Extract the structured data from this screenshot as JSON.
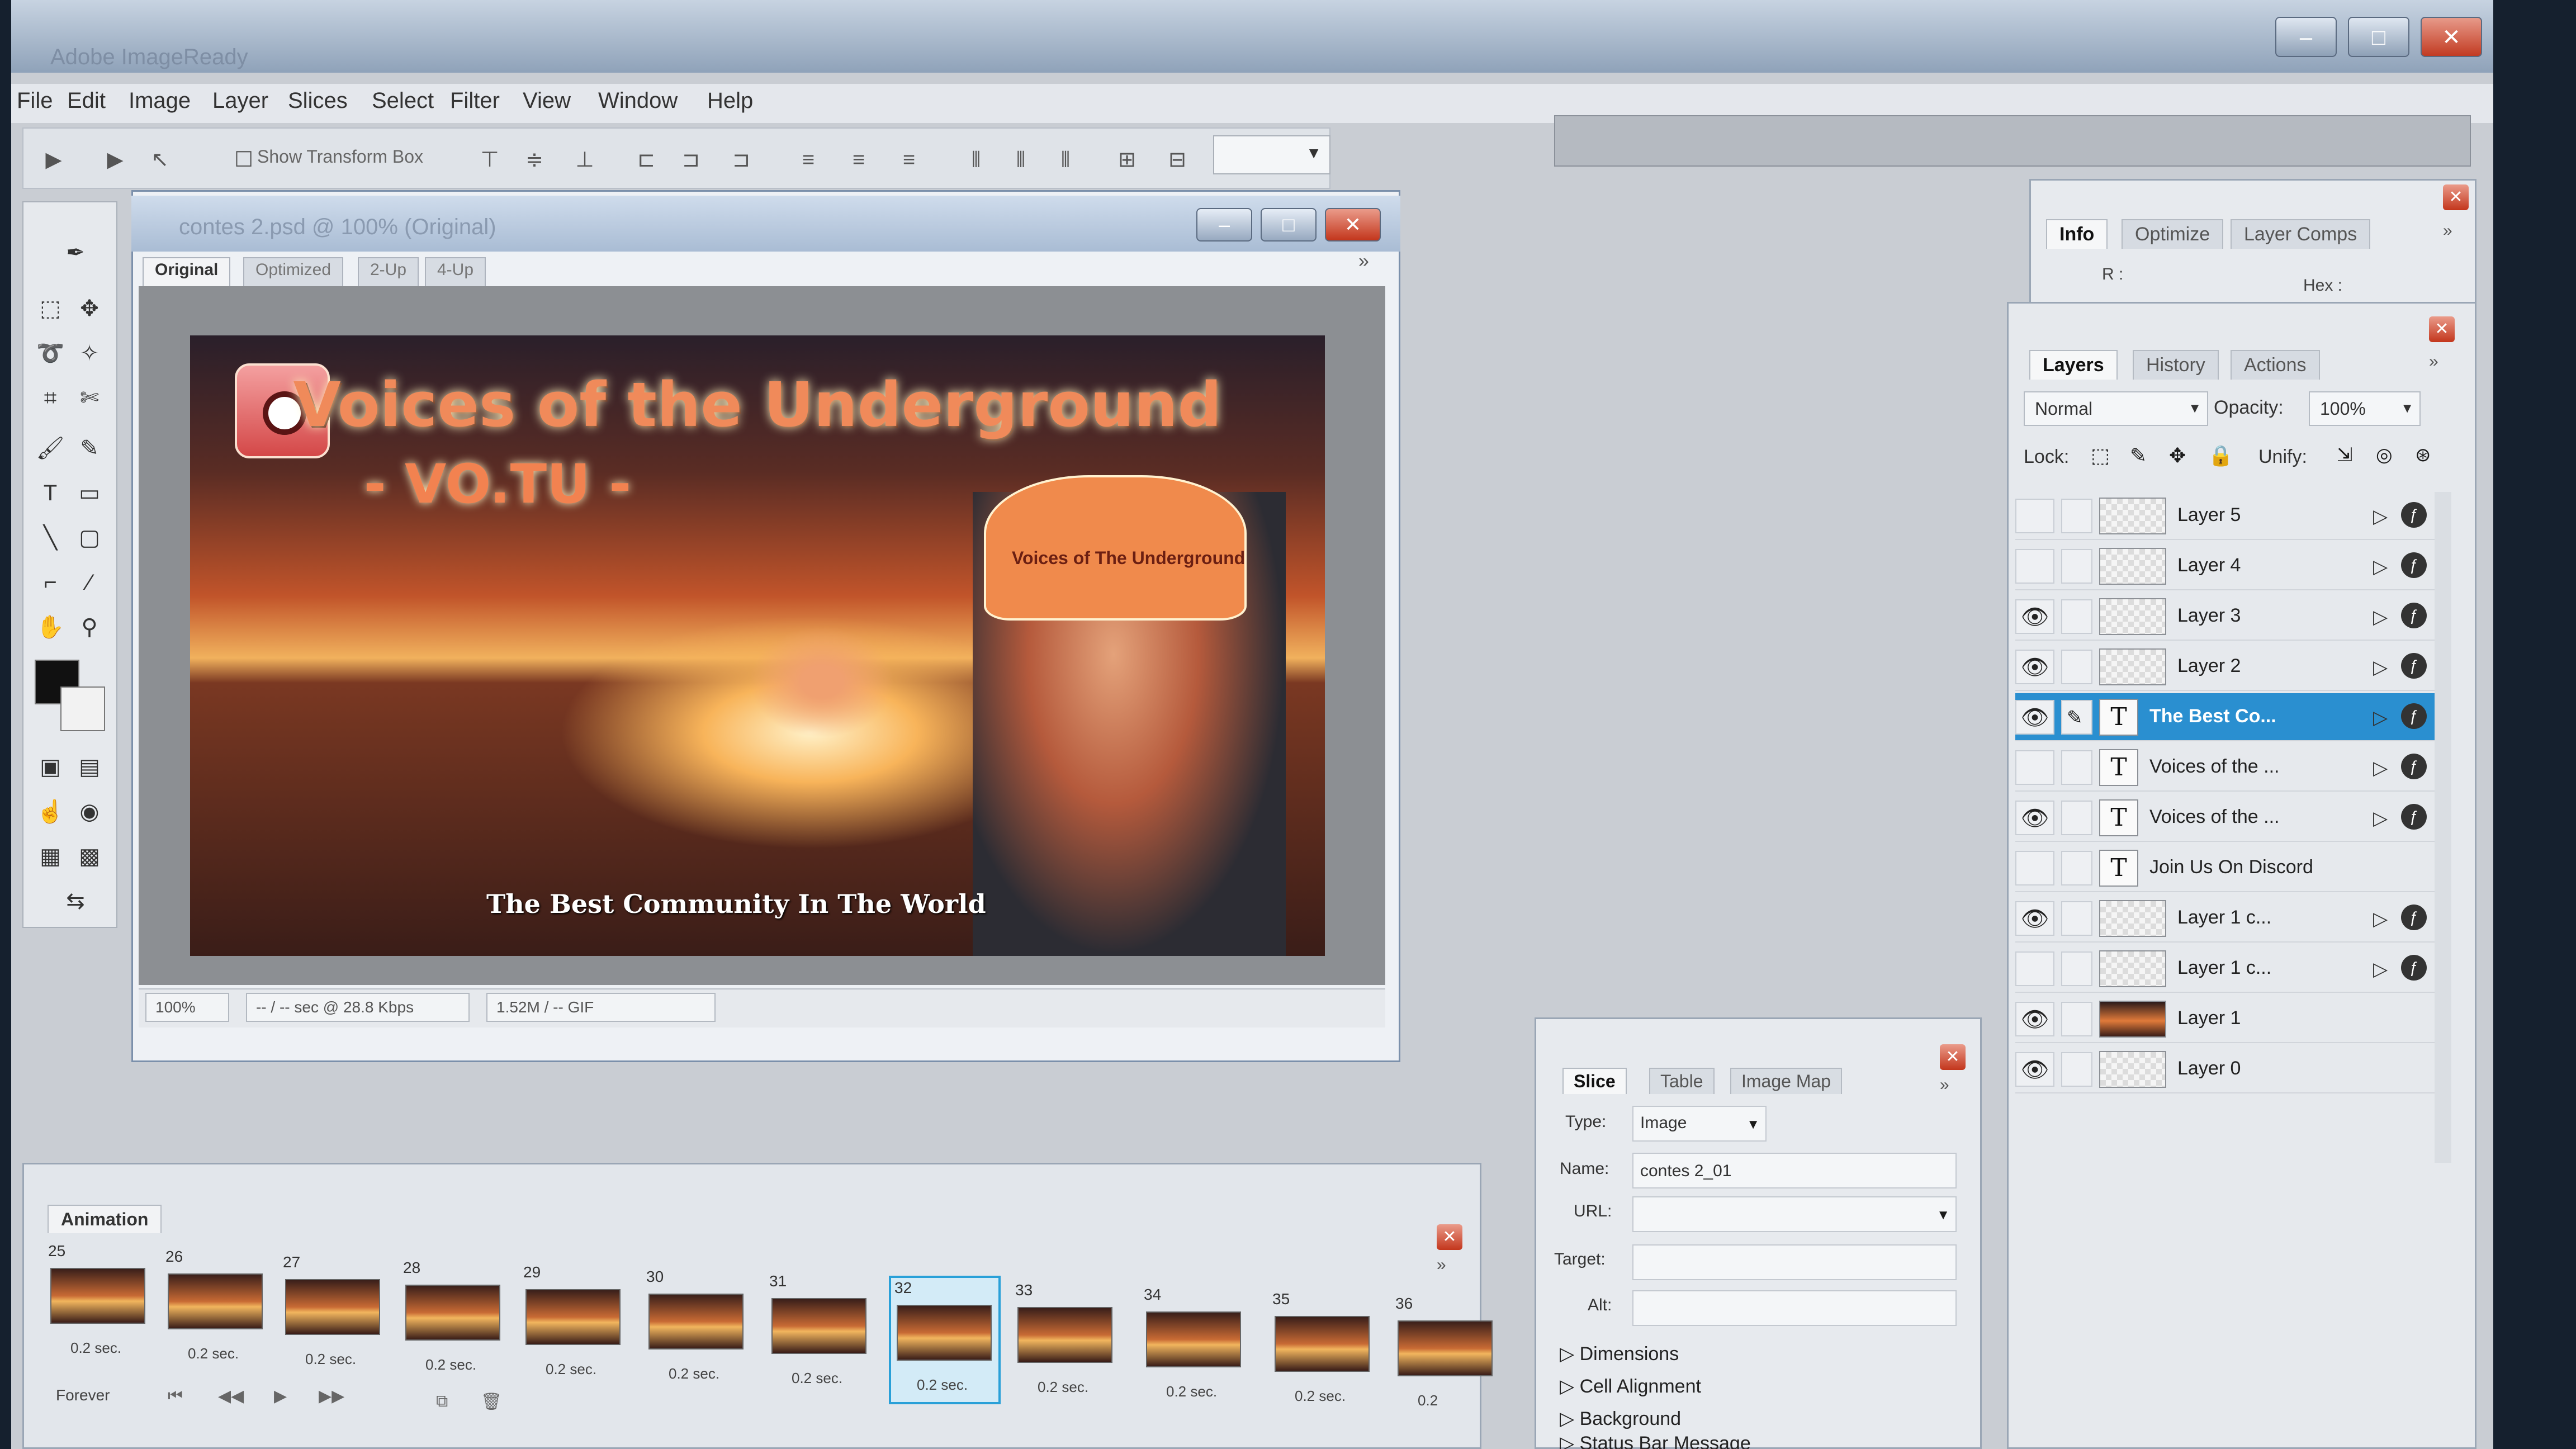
{
  "app": {
    "title": "Adobe ImageReady",
    "window_buttons": {
      "minimize": "–",
      "maximize": "□",
      "close": "✕"
    }
  },
  "menu": [
    "File",
    "Edit",
    "Image",
    "Layer",
    "Slices",
    "Select",
    "Filter",
    "View",
    "Window",
    "Help"
  ],
  "toolbar": {
    "show_transform_label": "Show Transform Box"
  },
  "document": {
    "title": "contes 2.psd @ 100% (Original)",
    "tabs": [
      "Original",
      "Optimized",
      "2-Up",
      "4-Up"
    ],
    "artwork": {
      "title": "Voices of the Underground",
      "subtitle": "- VO.TU -",
      "tagline": "The Best Community In The World",
      "hat_text": "Voices of The Underground"
    },
    "status": {
      "zoom": "100%",
      "download": "-- / -- sec @ 28.8 Kbps",
      "size": "1.52M / -- GIF"
    }
  },
  "animation": {
    "tab": "Animation",
    "loop": "Forever",
    "selected_frame": "32",
    "frames": [
      {
        "num": "25",
        "delay": "0.2 sec."
      },
      {
        "num": "26",
        "delay": "0.2 sec."
      },
      {
        "num": "27",
        "delay": "0.2 sec."
      },
      {
        "num": "28",
        "delay": "0.2 sec."
      },
      {
        "num": "29",
        "delay": "0.2 sec."
      },
      {
        "num": "30",
        "delay": "0.2 sec."
      },
      {
        "num": "31",
        "delay": "0.2 sec."
      },
      {
        "num": "32",
        "delay": "0.2 sec."
      },
      {
        "num": "33",
        "delay": "0.2 sec."
      },
      {
        "num": "34",
        "delay": "0.2 sec."
      },
      {
        "num": "35",
        "delay": "0.2 sec."
      },
      {
        "num": "36",
        "delay": "0.2"
      }
    ]
  },
  "slice": {
    "tabs": [
      "Slice",
      "Table",
      "Image Map"
    ],
    "type_label": "Type:",
    "type_value": "Image",
    "name_label": "Name:",
    "name_value": "contes 2_01",
    "url_label": "URL:",
    "target_label": "Target:",
    "alt_label": "Alt:",
    "sections": [
      "Dimensions",
      "Cell Alignment",
      "Background",
      "Status Bar Message"
    ]
  },
  "info_palette": {
    "tabs": [
      "Info",
      "Optimize",
      "Layer Comps"
    ],
    "r_label": "R :",
    "hex_label": "Hex :"
  },
  "layers_palette": {
    "tabs": [
      "Layers",
      "History",
      "Actions"
    ],
    "blend_mode": "Normal",
    "opacity_label": "Opacity:",
    "opacity_value": "100%",
    "lock_label": "Lock:",
    "unify_label": "Unify:",
    "layers": [
      {
        "name": "Layer 5",
        "visible": false,
        "kind": "empty",
        "has_fx": true
      },
      {
        "name": "Layer 4",
        "visible": false,
        "kind": "empty",
        "has_fx": true
      },
      {
        "name": "Layer 3",
        "visible": true,
        "kind": "empty",
        "has_fx": true
      },
      {
        "name": "Layer 2",
        "visible": true,
        "kind": "empty",
        "has_fx": true
      },
      {
        "name": "The Best Co...",
        "visible": true,
        "kind": "text",
        "has_fx": true,
        "selected": true
      },
      {
        "name": "Voices of the ...",
        "visible": false,
        "kind": "text",
        "has_fx": true
      },
      {
        "name": "Voices of the ...",
        "visible": true,
        "kind": "text",
        "has_fx": true
      },
      {
        "name": "Join Us On Discord",
        "visible": false,
        "kind": "text",
        "has_fx": false
      },
      {
        "name": "Layer 1 c...",
        "visible": true,
        "kind": "empty",
        "has_fx": true
      },
      {
        "name": "Layer 1 c...",
        "visible": false,
        "kind": "empty",
        "has_fx": true
      },
      {
        "name": "Layer 1",
        "visible": true,
        "kind": "image",
        "has_fx": false
      },
      {
        "name": "Layer 0",
        "visible": true,
        "kind": "empty",
        "has_fx": false
      }
    ]
  }
}
